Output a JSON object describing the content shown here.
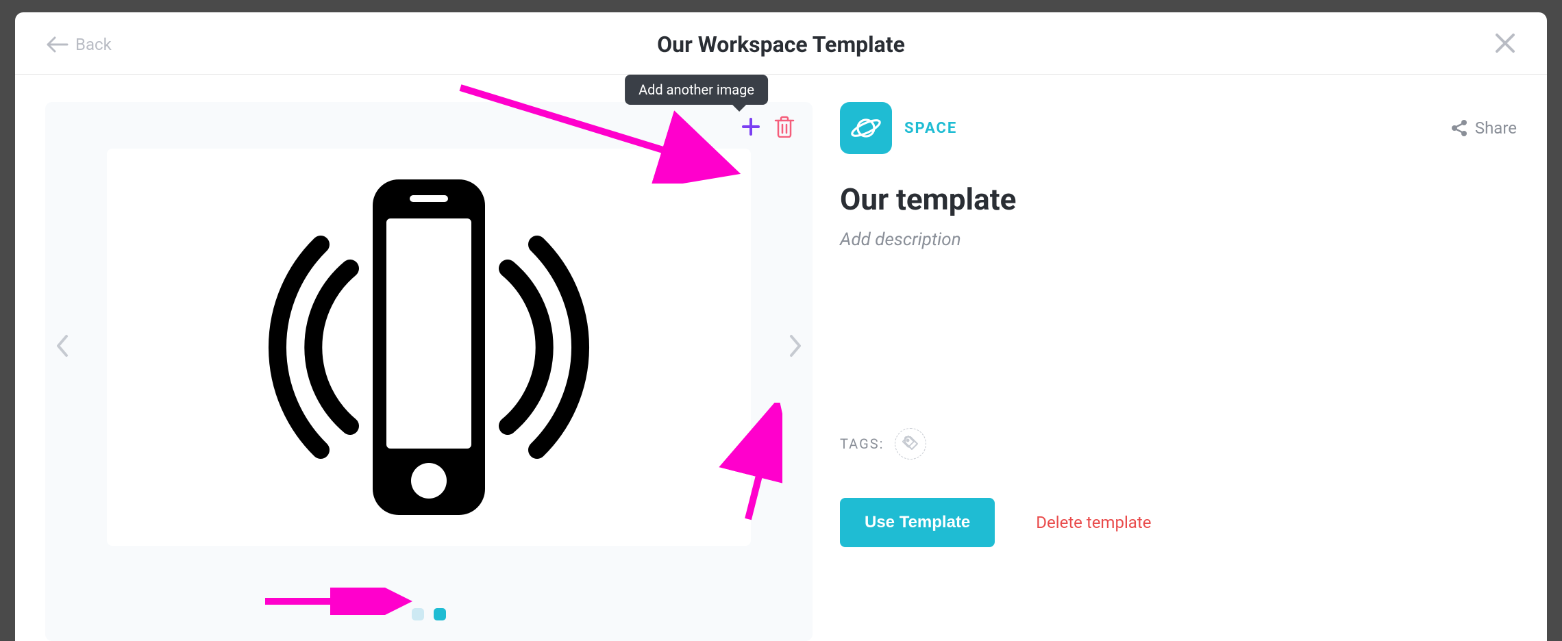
{
  "header": {
    "back_label": "Back",
    "title": "Our Workspace Template"
  },
  "gallery": {
    "tooltip": "Add another image",
    "dots_count": 2,
    "active_dot": 1
  },
  "details": {
    "space_label": "SPACE",
    "share_label": "Share",
    "title": "Our template",
    "description_placeholder": "Add description",
    "tags_label": "TAGS:",
    "use_button": "Use Template",
    "delete_link": "Delete template"
  }
}
